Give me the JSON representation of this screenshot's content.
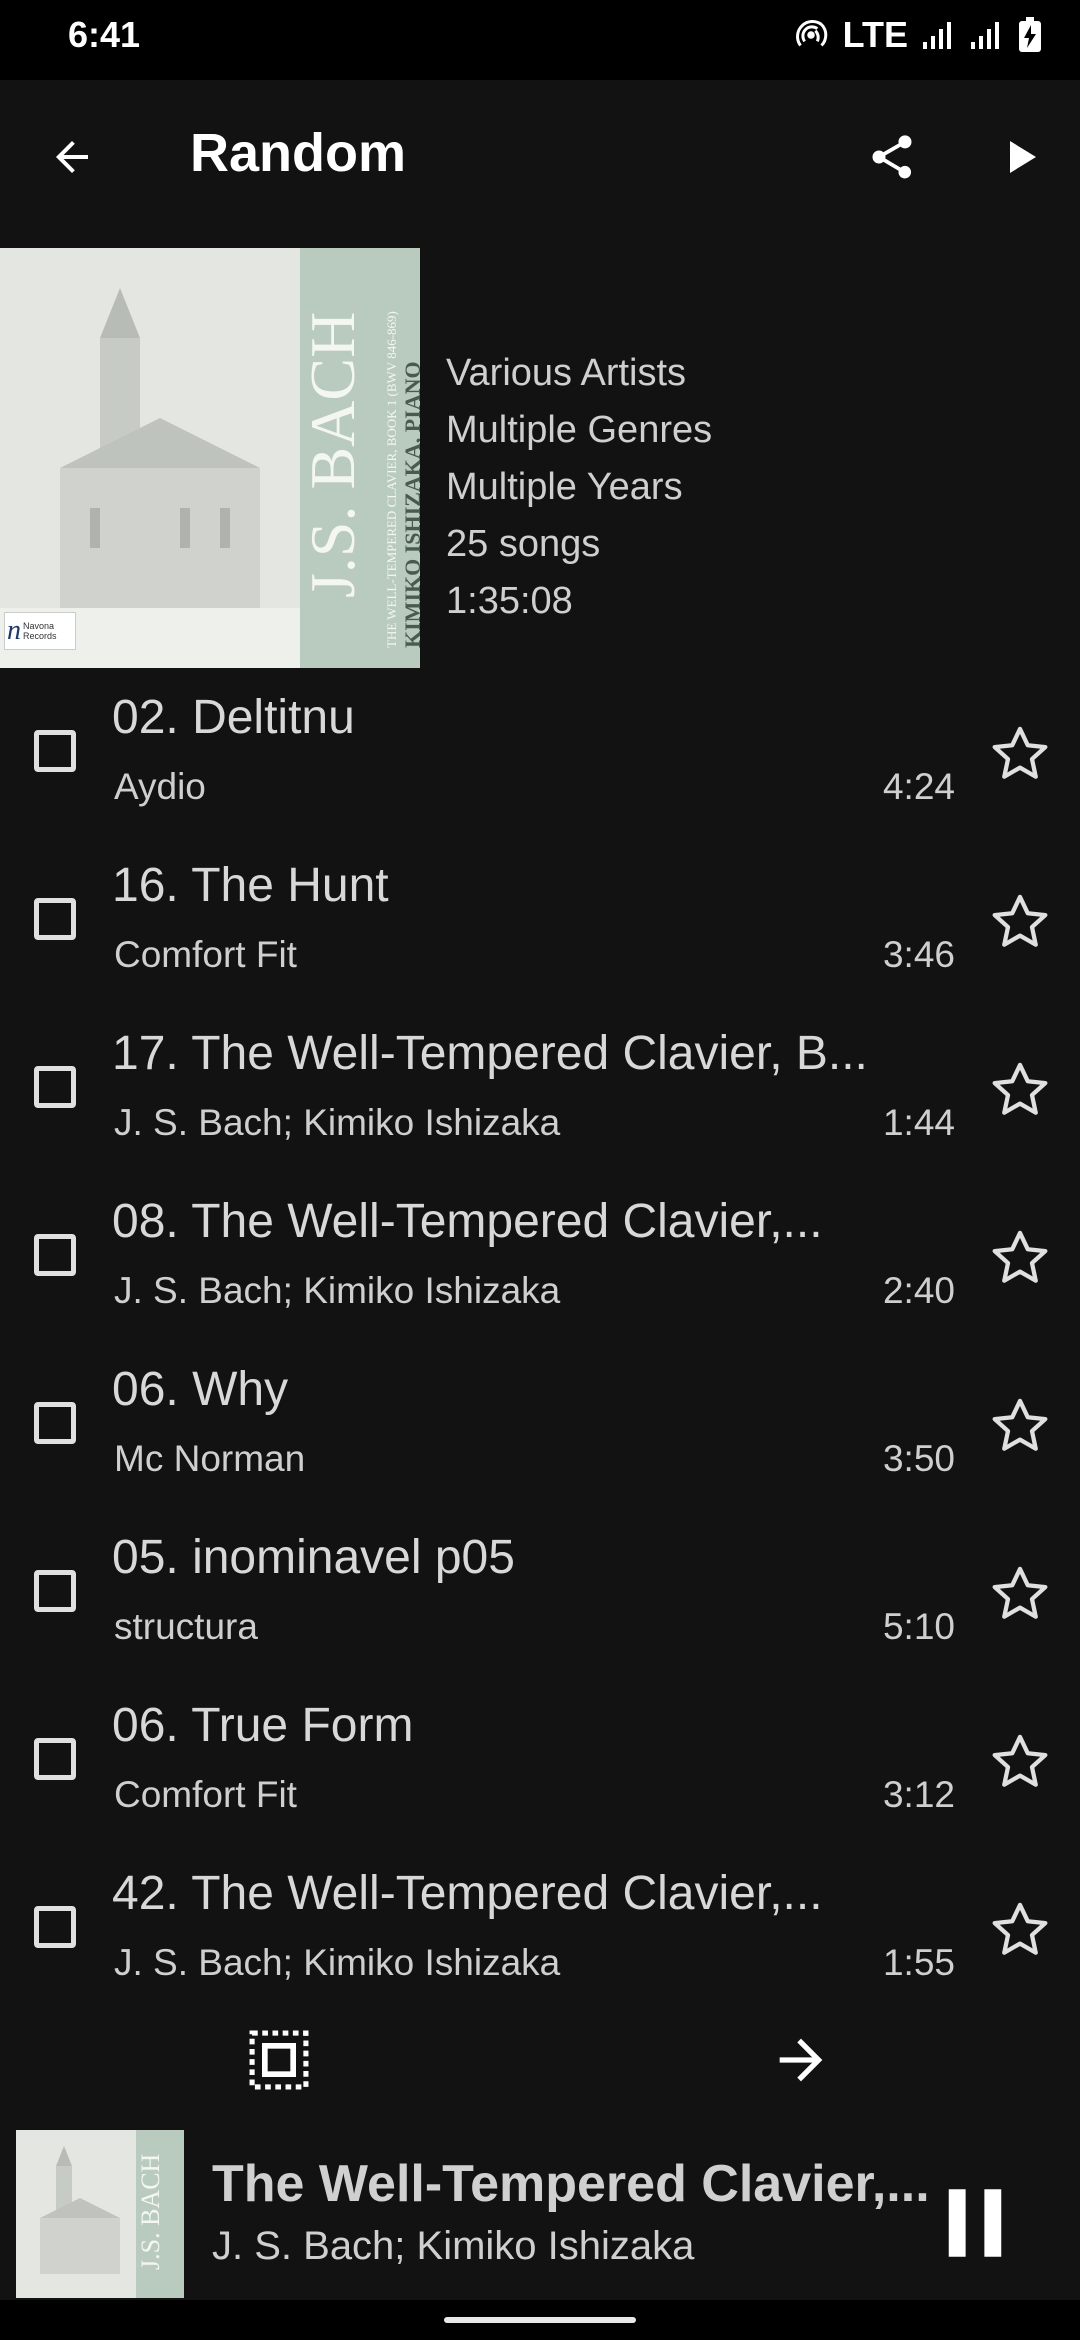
{
  "status_bar": {
    "time": "6:41",
    "network": "LTE"
  },
  "app_bar": {
    "title": "Random",
    "back_icon": "arrow-back-icon",
    "share_icon": "share-icon",
    "play_icon": "play-icon"
  },
  "album_cover": {
    "text_main": "J.S. BACH",
    "text_sub": "THE WELL-TEMPERED CLAVIER, BOOK 1 (BWV 846-869)",
    "text_artist": "KIMIKO ISHIZAKA, PIANO",
    "label": "Navona Records"
  },
  "playlist_info": {
    "artists": "Various Artists",
    "genres": "Multiple Genres",
    "years": "Multiple Years",
    "count": "25 songs",
    "duration": "1:35:08"
  },
  "tracks": [
    {
      "title": "02. Deltitnu",
      "artist": "Aydio",
      "duration": "4:24"
    },
    {
      "title": "16. The Hunt",
      "artist": "Comfort Fit",
      "duration": "3:46"
    },
    {
      "title": "17. The Well-Tempered Clavier, B...",
      "artist": "J. S. Bach; Kimiko Ishizaka",
      "duration": "1:44"
    },
    {
      "title": "08. The Well-Tempered Clavier,...",
      "artist": "J. S. Bach; Kimiko Ishizaka",
      "duration": "2:40"
    },
    {
      "title": "06. Why",
      "artist": "Mc Norman",
      "duration": "3:50"
    },
    {
      "title": "05. inominavel p05",
      "artist": "structura",
      "duration": "5:10"
    },
    {
      "title": "06. True Form",
      "artist": "Comfort Fit",
      "duration": "3:12"
    },
    {
      "title": "42. The Well-Tempered Clavier,...",
      "artist": "J. S. Bach; Kimiko Ishizaka",
      "duration": "1:55"
    }
  ],
  "bottom_bar": {
    "select_icon": "select-all-icon",
    "next_icon": "arrow-forward-icon"
  },
  "now_playing": {
    "title": "The Well-Tempered Clavier,...",
    "artist": "J. S. Bach; Kimiko Ishizaka",
    "control_icon": "pause-icon"
  },
  "colors": {
    "background": "#121212",
    "text": "#e6e6e6",
    "status_bar": "#000000"
  }
}
